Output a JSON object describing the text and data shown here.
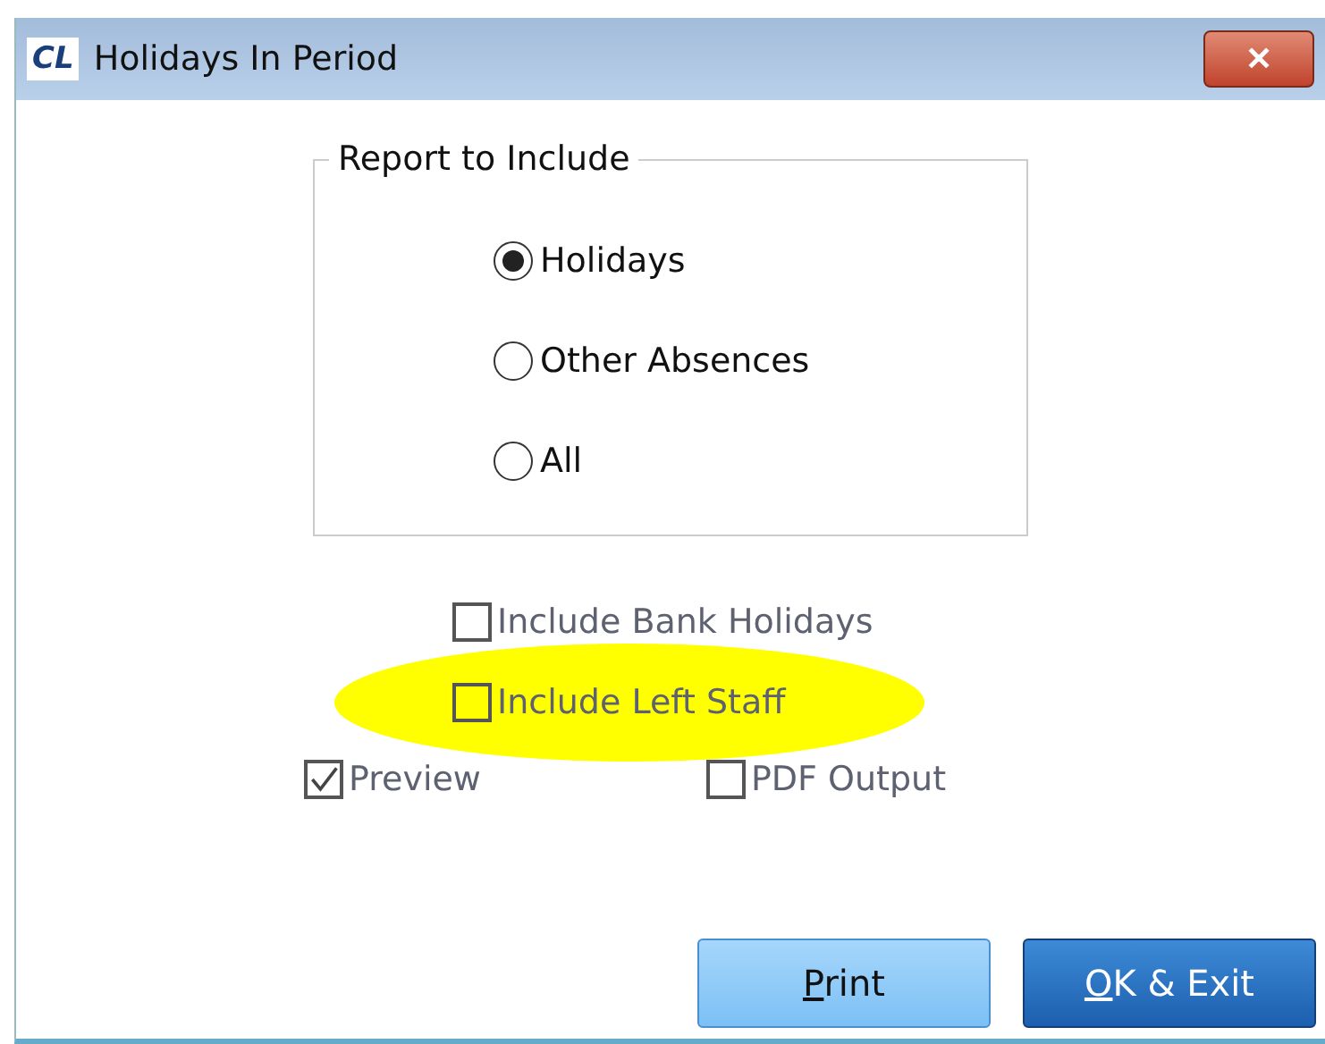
{
  "window": {
    "title": "Holidays In Period",
    "logo": "CL",
    "close_glyph": "✕"
  },
  "report_group": {
    "legend": "Report to Include",
    "options": [
      {
        "label": "Holidays",
        "selected": true
      },
      {
        "label": "Other Absences",
        "selected": false
      },
      {
        "label": "All",
        "selected": false
      }
    ]
  },
  "options": [
    {
      "label": "Include Bank Holidays",
      "checked": false,
      "highlighted": false
    },
    {
      "label": "Include Left Staff",
      "checked": false,
      "highlighted": true
    }
  ],
  "output_options": [
    {
      "label": "Preview",
      "checked": true
    },
    {
      "label": "PDF Output",
      "checked": false
    }
  ],
  "buttons": [
    {
      "label": "Print",
      "first_letter_underlined": true,
      "kind": "light"
    },
    {
      "label": "OK & Exit",
      "first_letter_underlined": true,
      "kind": "dark"
    }
  ]
}
